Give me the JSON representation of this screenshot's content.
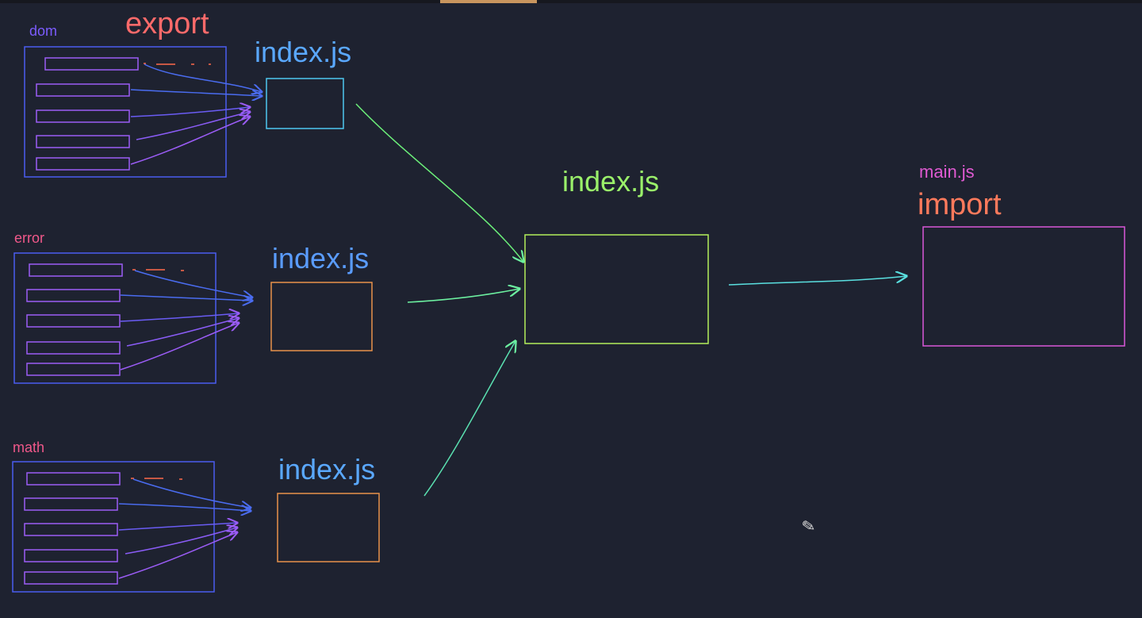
{
  "canvas": {
    "background": "#1e2230"
  },
  "labels": {
    "dom": "dom",
    "export": "export",
    "error": "error",
    "math": "math",
    "index_dom": "index.js",
    "index_error": "index.js",
    "index_math": "index.js",
    "index_center": "index.js",
    "main_file": "main.js",
    "import": "import"
  },
  "colors": {
    "module_label_purple": "#7c5cff",
    "module_label_pink": "#f0588a",
    "export_coral": "#ff6a6a",
    "index_blue": "#5aa8ff",
    "index_center_green": "#9af06a",
    "main_pink": "#e05ad2",
    "import_coral": "#ff7a5c",
    "module_box_blue": "#4a5cf0",
    "file_item_purple": "#9b5cf6",
    "cyan_box": "#4fc8f0",
    "orange_box": "#e8924a",
    "green_box": "#b4f05a",
    "magenta_box": "#d858d8",
    "arrow_blue": "#4a6cf0",
    "arrow_purple": "#9b5cf6",
    "arrow_green": "#6cf0a0",
    "arrow_cyan": "#5ae0e0"
  },
  "cursor": {
    "icon": "pencil-cursor-icon",
    "glyph": "✎"
  }
}
